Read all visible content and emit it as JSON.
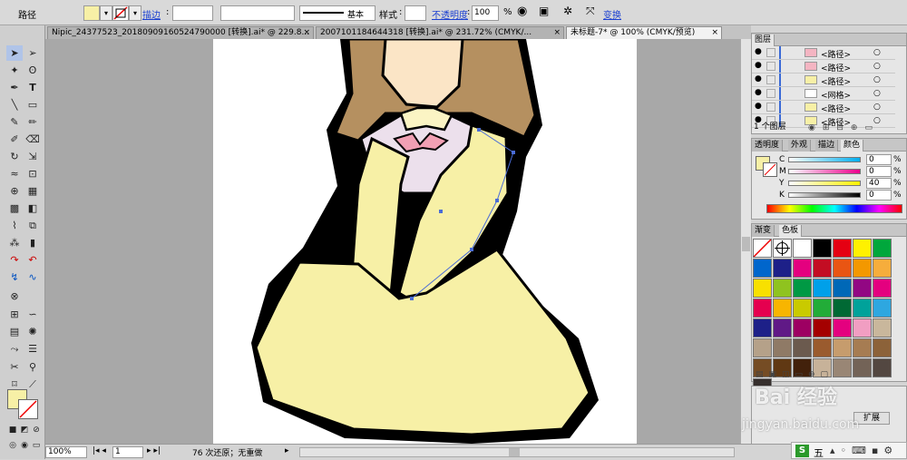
{
  "control_bar": {
    "object_type": "路径",
    "stroke_label": "描边",
    "stroke_profile": "基本",
    "style_label": "样式",
    "opacity_label": "不透明度",
    "opacity_value": "100",
    "opacity_unit": "%",
    "transform_label": "变换",
    "fill_color": "#f7f0a6"
  },
  "tabs": [
    {
      "label": "Nipic_24377523_20180909160524790000 [转换].ai* @ 229.8..."
    },
    {
      "label": "20071011846443​18 [转换].ai* @ 231.72% (CMYK/..."
    },
    {
      "label": "未标题-7* @ 100% (CMYK/预览)"
    }
  ],
  "status_bar": {
    "zoom": "100%",
    "page": "1",
    "history": "76 次还原；无重做"
  },
  "layers_panel": {
    "title": "图层",
    "rows": [
      {
        "name": "<路径>",
        "thumb": "#f4b5c2"
      },
      {
        "name": "<路径>",
        "thumb": "#f4b5c2"
      },
      {
        "name": "<路径>",
        "thumb": "#f7f0a6"
      },
      {
        "name": "<网格>",
        "thumb": "#ffffff"
      },
      {
        "name": "<路径>",
        "thumb": "#f7f0a6"
      },
      {
        "name": "<路径>",
        "thumb": "#f7f0a6"
      }
    ],
    "footer": "1 个图层"
  },
  "color_panel": {
    "tabs": [
      "透明度",
      "外观",
      "描边",
      "颜色"
    ],
    "channels": [
      {
        "label": "C",
        "value": "0"
      },
      {
        "label": "M",
        "value": "0"
      },
      {
        "label": "Y",
        "value": "40"
      },
      {
        "label": "K",
        "value": "0"
      }
    ]
  },
  "swatches_panel": {
    "tabs": [
      "渐变",
      "色板"
    ],
    "colors": [
      "#ffffff",
      "#000000",
      "#e50012",
      "#fff100",
      "#00a73c",
      "#0066cc",
      "#1d2088",
      "#e4007f",
      "#c30d23",
      "#e95513",
      "#f39800",
      "#f6ad3c",
      "#f8e000",
      "#8fc31f",
      "#009944",
      "#00a0e9",
      "#0068b7",
      "#920783",
      "#e4007f",
      "#e5004f",
      "#f8b500",
      "#c9ca00",
      "#22ac38",
      "#006934",
      "#00a29a",
      "#2ea7e0",
      "#1d2088",
      "#601986",
      "#9d0062",
      "#a40000",
      "#e4007f",
      "#f19ec2",
      "#c9b79c",
      "#b5a189",
      "#8f7a66",
      "#6b5a4e",
      "#9a5b2e",
      "#c69c6d",
      "#a67c52",
      "#8c6239",
      "#754c24",
      "#603813",
      "#42210b",
      "#c7b299",
      "#998675",
      "#736357",
      "#534741",
      "#362f2d"
    ],
    "extend_label": "扩展"
  },
  "watermark": {
    "brand": "Bai 经验",
    "url": "jingyan.baidu.com"
  },
  "taskbar": {
    "label": "五"
  }
}
